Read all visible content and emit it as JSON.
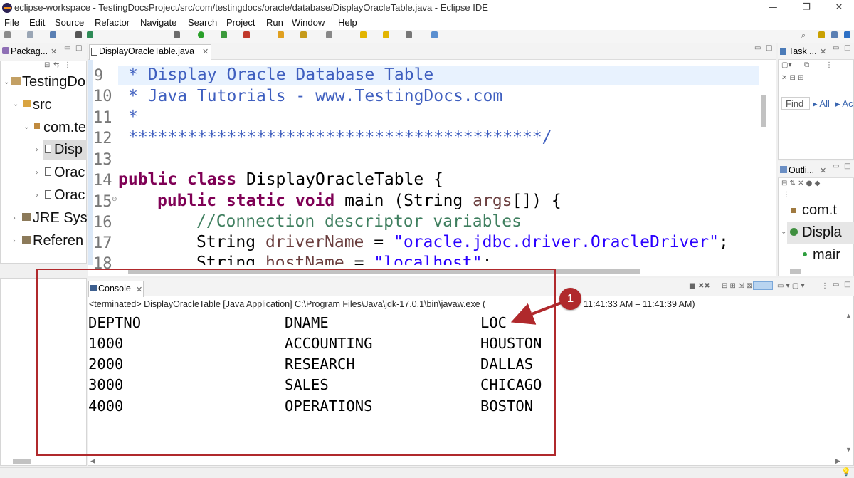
{
  "window": {
    "title": "eclipse-workspace - TestingDocsProject/src/com/testingdocs/oracle/database/DisplayOracleTable.java - Eclipse IDE",
    "minimize": "—",
    "restore": "❐",
    "close": "✕"
  },
  "menu": [
    "File",
    "Edit",
    "Source",
    "Refactor",
    "Navigate",
    "Search",
    "Project",
    "Run",
    "Window",
    "Help"
  ],
  "package_explorer": {
    "tab_label": "Packag...",
    "items": [
      "TestingDo",
      "src",
      "com.te",
      "Disp",
      "Orac",
      "Orac",
      "JRE Syst",
      "Referen"
    ]
  },
  "editor": {
    "tab_label": "DisplayOracleTable.java",
    "line_numbers": [
      "9",
      "10",
      "11",
      "12",
      "13",
      "14",
      "15",
      "16",
      "17",
      "18"
    ],
    "lines": {
      "l9": "* Display Oracle Database Table",
      "l10": "* Java Tutorials - www.TestingDocs.com",
      "l11": "*",
      "l12": "******************************************/",
      "l14_kw": "public class",
      "l14_rest": " DisplayOracleTable {",
      "l15_kw": "public static void",
      "l15_a": " main (String ",
      "l15_var": "args",
      "l15_b": "[]) {",
      "l16": "//Connection descriptor variables",
      "l17_a": "String ",
      "l17_var": "driverName",
      "l17_b": " = ",
      "l17_str": "\"oracle.jdbc.driver.OracleDriver\"",
      "l17_c": ";",
      "l18_a": "String ",
      "l18_var": "hostName",
      "l18_b": " = ",
      "l18_str": "\"localhost\"",
      "l18_c": ";"
    }
  },
  "task_view": {
    "tab_label": "Task ...",
    "find_placeholder": "Find",
    "all_label": "All",
    "ac_label": "Ac"
  },
  "outline_view": {
    "tab_label": "Outli...",
    "items": [
      "com.t",
      "Displa",
      "mair"
    ]
  },
  "console": {
    "tab_label": "Console",
    "status": "<terminated> DisplayOracleTable [Java Application] C:\\Program Files\\Java\\jdk-17.0.1\\bin\\javaw.exe  (",
    "status_tail": "11:41:33 AM – 11:41:39 AM)",
    "table": {
      "headers": [
        "DEPTNO",
        "DNAME",
        "LOC"
      ],
      "rows": [
        [
          "1000",
          "ACCOUNTING",
          "HOUSTON"
        ],
        [
          "2000",
          "RESEARCH",
          "DALLAS"
        ],
        [
          "3000",
          "SALES",
          "CHICAGO"
        ],
        [
          "4000",
          "OPERATIONS",
          "BOSTON"
        ]
      ]
    }
  },
  "annotation": {
    "badge_number": "1",
    "highlight_color": "#b0292c"
  }
}
